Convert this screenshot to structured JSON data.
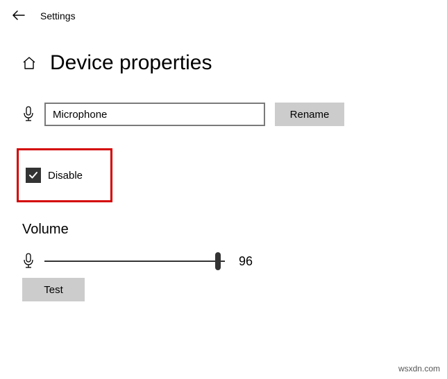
{
  "header": {
    "settings_label": "Settings"
  },
  "page": {
    "title": "Device properties"
  },
  "rename": {
    "device_name": "Microphone",
    "button_label": "Rename"
  },
  "disable": {
    "label": "Disable",
    "checked": true
  },
  "volume": {
    "heading": "Volume",
    "value": 96,
    "test_button_label": "Test"
  },
  "watermark": "wsxdn.com"
}
